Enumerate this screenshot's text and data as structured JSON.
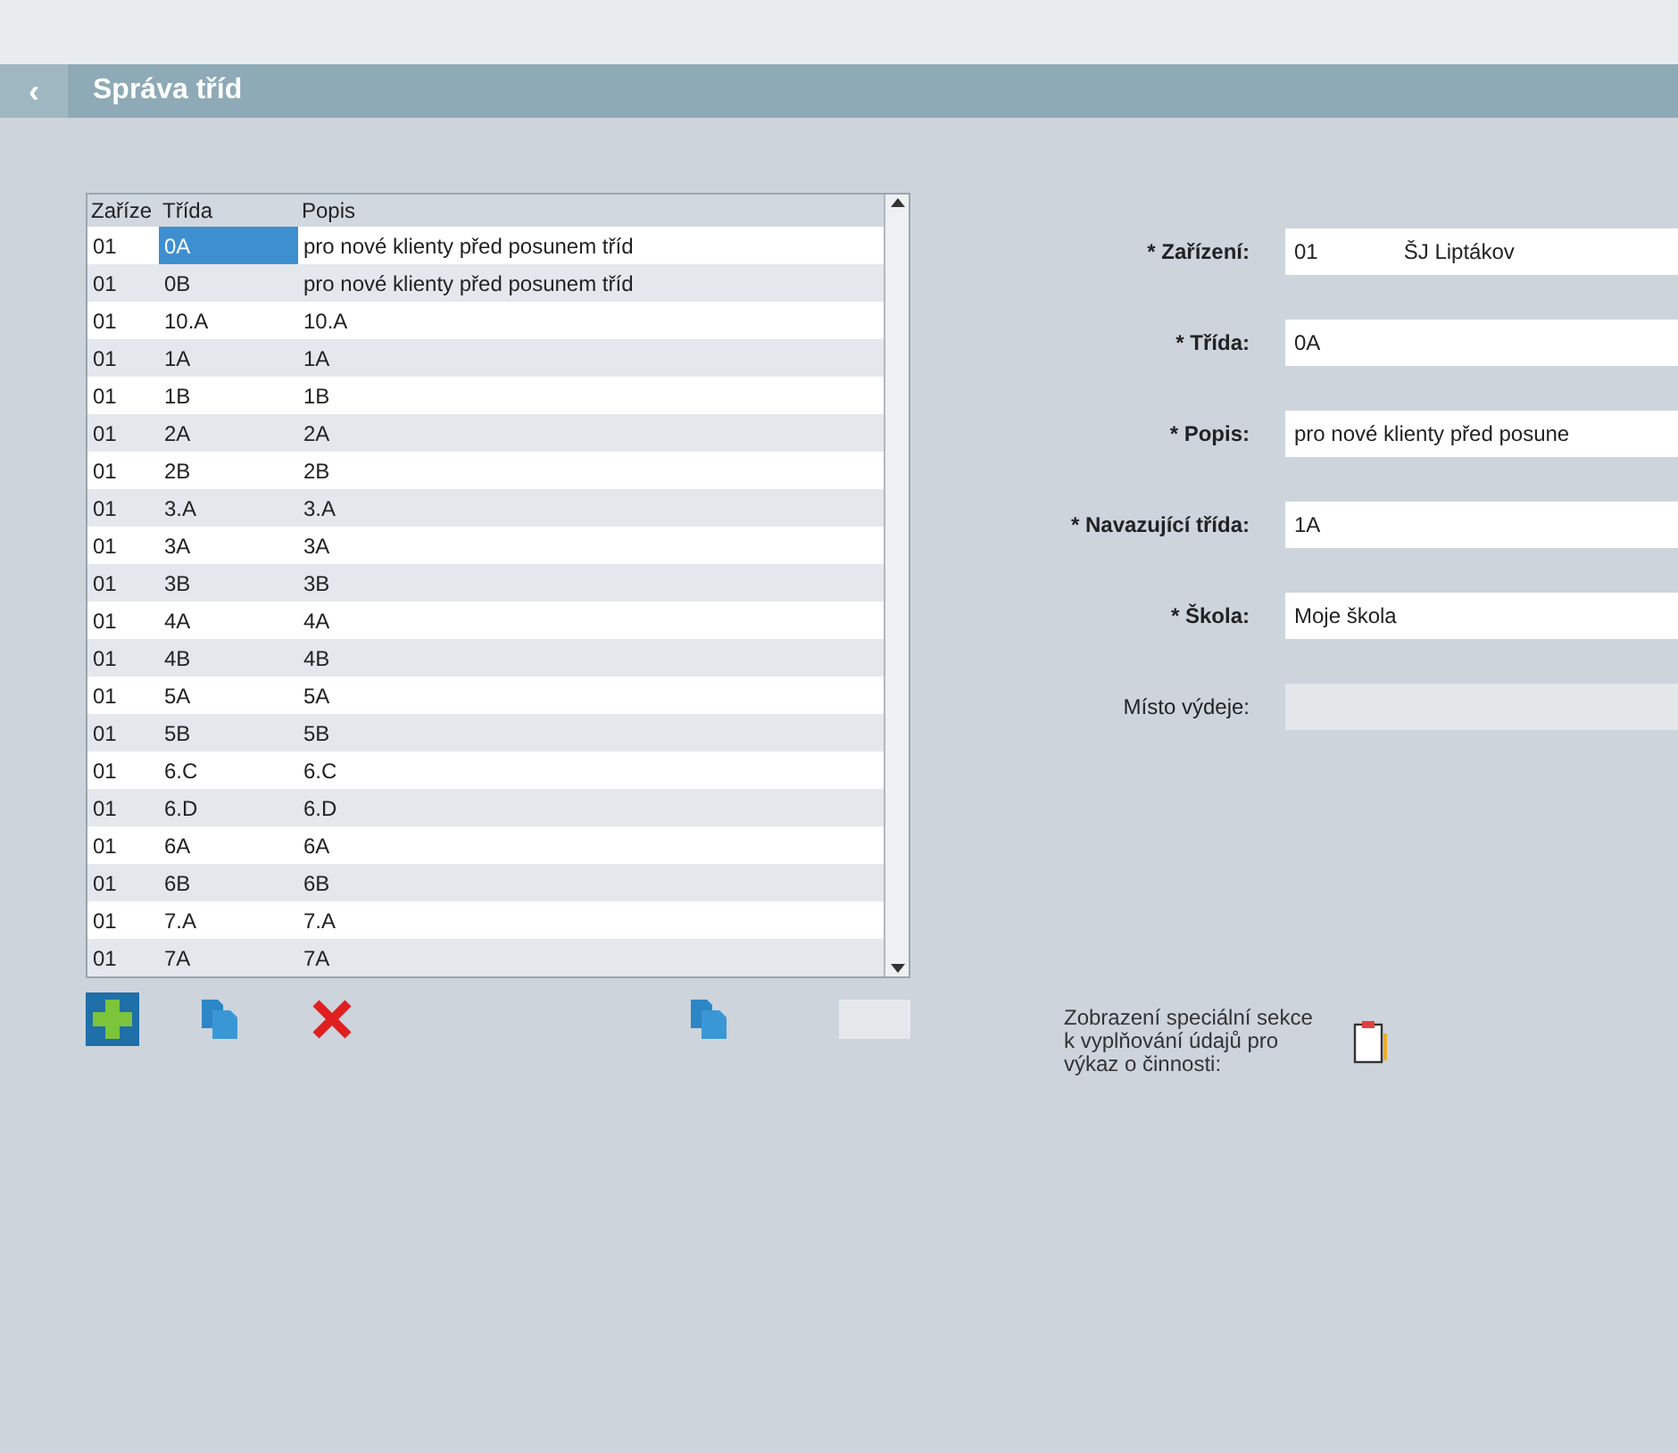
{
  "header": {
    "title": "Správa tříd",
    "collapse_icon": "‹"
  },
  "table": {
    "columns": [
      "Zaříze",
      "Třída",
      "Popis"
    ],
    "rows": [
      {
        "cells": [
          "01",
          "0A",
          "pro nové klienty před posunem tříd"
        ],
        "selected": true
      },
      {
        "cells": [
          "01",
          "0B",
          "pro nové klienty před posunem tříd"
        ],
        "selected": false
      },
      {
        "cells": [
          "01",
          "10.A",
          "10.A"
        ],
        "selected": false
      },
      {
        "cells": [
          "01",
          "1A",
          "1A"
        ],
        "selected": false
      },
      {
        "cells": [
          "01",
          "1B",
          "1B"
        ],
        "selected": false
      },
      {
        "cells": [
          "01",
          "2A",
          "2A"
        ],
        "selected": false
      },
      {
        "cells": [
          "01",
          "2B",
          "2B"
        ],
        "selected": false
      },
      {
        "cells": [
          "01",
          "3.A",
          "3.A"
        ],
        "selected": false
      },
      {
        "cells": [
          "01",
          "3A",
          "3A"
        ],
        "selected": false
      },
      {
        "cells": [
          "01",
          "3B",
          "3B"
        ],
        "selected": false
      },
      {
        "cells": [
          "01",
          "4A",
          "4A"
        ],
        "selected": false
      },
      {
        "cells": [
          "01",
          "4B",
          "4B"
        ],
        "selected": false
      },
      {
        "cells": [
          "01",
          "5A",
          "5A"
        ],
        "selected": false
      },
      {
        "cells": [
          "01",
          "5B",
          "5B"
        ],
        "selected": false
      },
      {
        "cells": [
          "01",
          "6.C",
          "6.C"
        ],
        "selected": false
      },
      {
        "cells": [
          "01",
          "6.D",
          "6.D"
        ],
        "selected": false
      },
      {
        "cells": [
          "01",
          "6A",
          "6A"
        ],
        "selected": false
      },
      {
        "cells": [
          "01",
          "6B",
          "6B"
        ],
        "selected": false
      },
      {
        "cells": [
          "01",
          "7.A",
          "7.A"
        ],
        "selected": false
      },
      {
        "cells": [
          "01",
          "7A",
          "7A"
        ],
        "selected": false
      }
    ]
  },
  "toolbar": [
    {
      "kind": "add"
    },
    {
      "kind": "copy"
    },
    {
      "kind": "delete"
    },
    {
      "kind": "copy"
    },
    {
      "kind": "blank"
    }
  ],
  "form": [
    {
      "label": "* Zařízení:",
      "required": true,
      "value": "01",
      "value_2": "ŠJ Liptákov",
      "disabled": false
    },
    {
      "label": "* Třída:",
      "required": true,
      "value": "0A",
      "disabled": false
    },
    {
      "label": "* Popis:",
      "required": true,
      "value": "pro nové klienty před posune",
      "disabled": false
    },
    {
      "label": "* Navazující třída:",
      "required": true,
      "value": "1A",
      "disabled": false
    },
    {
      "label": "* Škola:",
      "required": true,
      "value": "Moje škola",
      "disabled": false
    },
    {
      "label": "Místo výdeje:",
      "required": false,
      "disabled": true
    }
  ],
  "special": {
    "label": "Zobrazení speciální sekce k vyplňování údajů pro výkaz o činnosti:"
  }
}
